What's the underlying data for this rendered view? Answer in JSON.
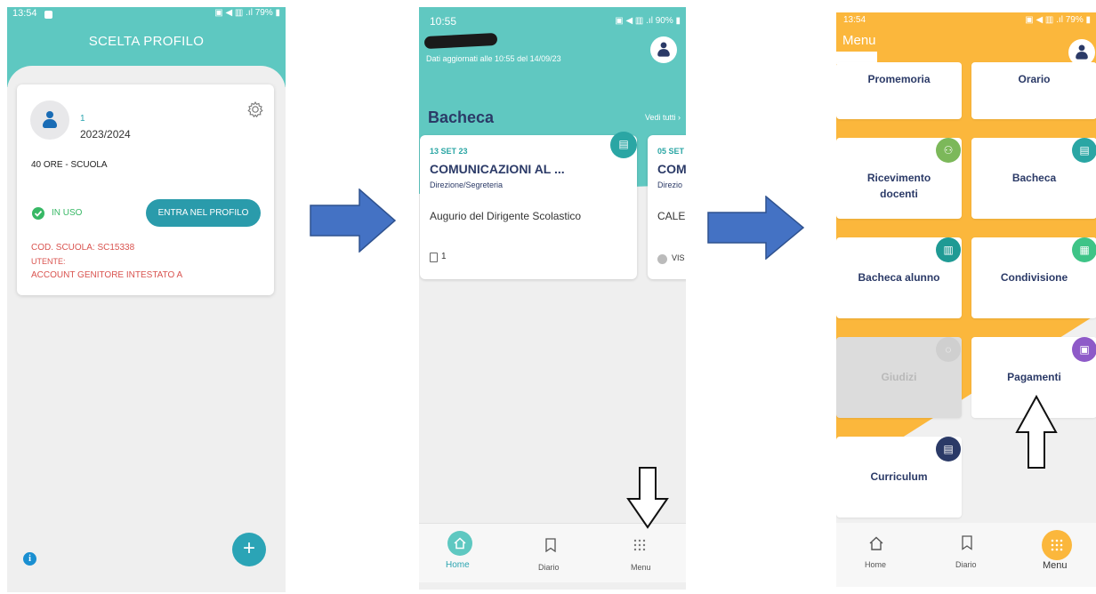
{
  "screen1": {
    "time": "13:54",
    "battery": "79%",
    "title": "SCELTA PROFILO",
    "profile_number": "1",
    "year": "2023/2024",
    "school_name": "40 ORE - SCUOLA",
    "in_use_label": "IN USO",
    "enter_button": "ENTRA NEL PROFILO",
    "school_code": "COD. SCUOLA: SC15338",
    "user_label": "UTENTE:",
    "account_label": "ACCOUNT GENITORE INTESTATO A",
    "fab_label": "+",
    "info_label": "i"
  },
  "screen2": {
    "time": "10:55",
    "battery": "90%",
    "updated_text": "Dati aggiornati alle 10:55 del 14/09/23",
    "section_title": "Bacheca",
    "see_all": "Vedi tutti ›",
    "cards": [
      {
        "date": "13 SET 23",
        "title": "COMUNICAZIONI AL ...",
        "sender": "Direzione/Segreteria",
        "body": "Augurio del Dirigente Scolastico",
        "count": "1"
      },
      {
        "date": "05 SET",
        "title": "COM",
        "sender": "Direzio",
        "body": "CALEI",
        "count": "VIS"
      }
    ],
    "tabs": [
      {
        "label": "Home",
        "icon": "home-icon",
        "active": true
      },
      {
        "label": "Diario",
        "icon": "bookmark-icon",
        "active": false
      },
      {
        "label": "Menu",
        "icon": "grid-dots-icon",
        "active": false
      }
    ]
  },
  "screen3": {
    "time": "13:54",
    "battery": "79%",
    "title": "Menu",
    "tiles": [
      {
        "label": "Promemoria"
      },
      {
        "label": "Orario"
      },
      {
        "label": "Ricevimento docenti",
        "badge_color": "#7cb85a"
      },
      {
        "label": "Bacheca",
        "badge_color": "#2aa6a4"
      },
      {
        "label": "Bacheca alunno",
        "badge_color": "#1f9a94"
      },
      {
        "label": "Condivisione",
        "badge_color": "#3ec487"
      },
      {
        "label": "Giudizi",
        "badge_color": "#cfcfcf",
        "disabled": true
      },
      {
        "label": "Pagamenti",
        "badge_color": "#8e5ac8"
      },
      {
        "label": "Curriculum",
        "badge_color": "#2b3a67"
      }
    ],
    "tabs": [
      {
        "label": "Home",
        "icon": "home-icon"
      },
      {
        "label": "Diario",
        "icon": "bookmark-icon"
      },
      {
        "label": "Menu",
        "icon": "grid-dots-icon",
        "active": true
      }
    ]
  },
  "colors": {
    "teal": "#5ec8c1",
    "orange": "#fbb73c",
    "navy": "#2b3a67",
    "arrow_blue": "#4472c4"
  }
}
